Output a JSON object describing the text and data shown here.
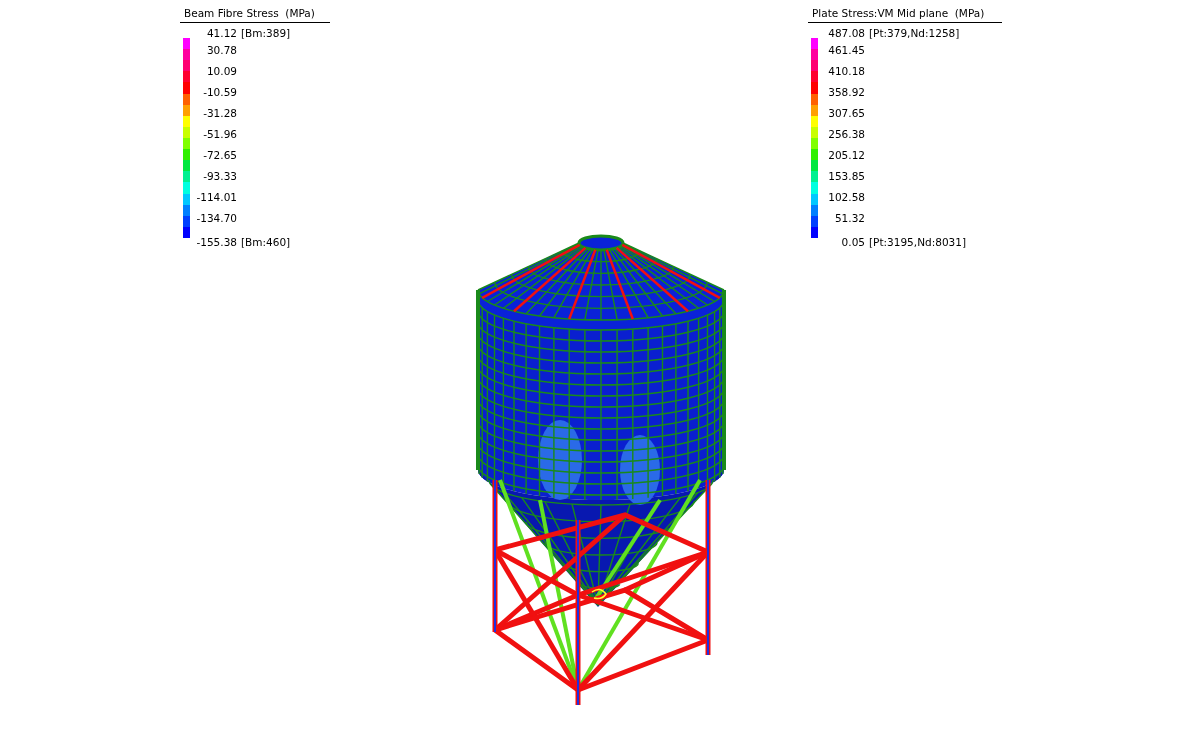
{
  "legends": [
    {
      "title": "Beam Fibre Stress  (MPa)",
      "max": {
        "value": "41.12",
        "note": "[Bm:389]"
      },
      "ticks": [
        "30.78",
        "10.09",
        "-10.59",
        "-31.28",
        "-51.96",
        "-72.65",
        "-93.33",
        "-114.01",
        "-134.70"
      ],
      "min": {
        "value": "-155.38",
        "note": "[Bm:460]"
      }
    },
    {
      "title": "Plate Stress:VM Mid plane  (MPa)",
      "max": {
        "value": "487.08",
        "note": "[Pt:379,Nd:1258]"
      },
      "ticks": [
        "461.45",
        "410.18",
        "358.92",
        "307.65",
        "256.38",
        "205.12",
        "153.85",
        "102.58",
        "51.32"
      ],
      "min": {
        "value": "0.05",
        "note": "[Pt:3195,Nd:8031]"
      }
    }
  ]
}
